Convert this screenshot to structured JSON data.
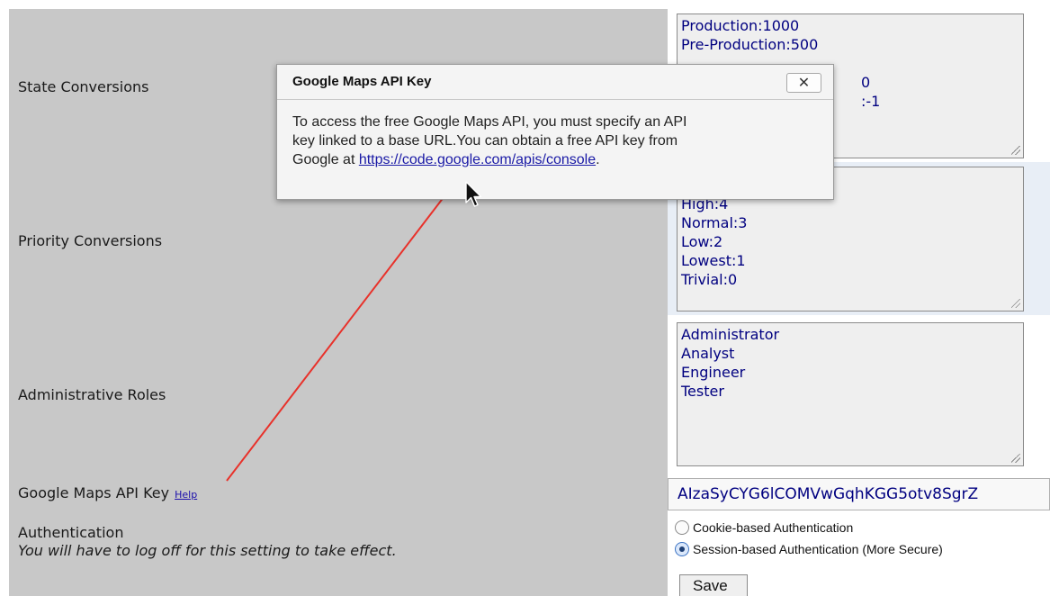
{
  "labels": {
    "state_conversions": "State Conversions",
    "priority_conversions": "Priority Conversions",
    "administrative_roles": "Administrative Roles",
    "google_maps_api_key": "Google Maps API Key",
    "help": "Help",
    "authentication": "Authentication",
    "auth_note": "You will have to log off for this setting to take effect."
  },
  "state_conversions": {
    "lines": [
      "Production:1000",
      "Pre-Production:500",
      "",
      "0",
      ":-1"
    ]
  },
  "priority_conversions": {
    "lines": [
      "High:4",
      "Normal:3",
      "Low:2",
      "Lowest:1",
      "Trivial:0"
    ]
  },
  "administrative_roles": {
    "lines": [
      "Administrator",
      "Analyst",
      "Engineer",
      "Tester"
    ]
  },
  "api_key": {
    "value": "AIzaSyCYG6lCOMVwGqhKGG5otv8SgrZ"
  },
  "authentication": {
    "options": [
      {
        "label": "Cookie-based Authentication",
        "selected": false
      },
      {
        "label": "Session-based Authentication (More Secure)",
        "selected": true
      }
    ]
  },
  "save_label": "Save",
  "dialog": {
    "title": "Google Maps API Key",
    "close_icon": "close-icon",
    "close_glyph": "✕",
    "body_line1": "To access the free Google Maps API, you must specify an API",
    "body_line2": "key linked to a base URL.You can obtain a free API key from",
    "body_line3_prefix": "Google at ",
    "link": "https://code.google.com/apis/console",
    "body_line3_suffix": "."
  },
  "colors": {
    "annotation_line": "#e8312a",
    "value_text": "#000080",
    "panel_bg": "#c8c8c8"
  }
}
